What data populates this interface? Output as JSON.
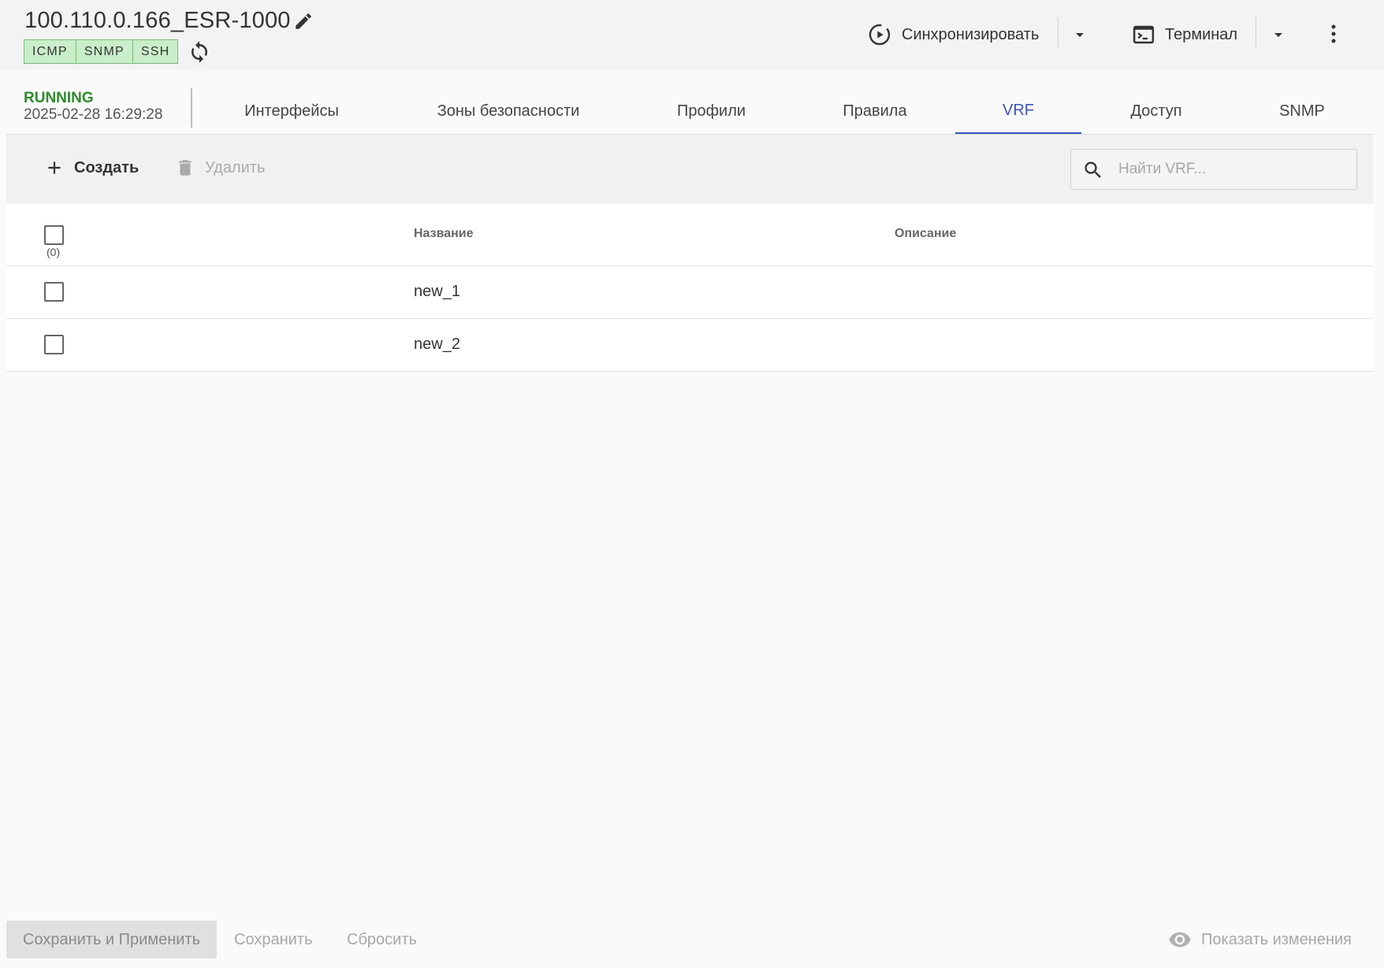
{
  "device": {
    "title": "100.110.0.166_ESR-1000",
    "protocols": [
      "ICMP",
      "SNMP",
      "SSH"
    ]
  },
  "header_actions": {
    "sync_label": "Синхронизировать",
    "terminal_label": "Терминал"
  },
  "status": {
    "state": "RUNNING",
    "timestamp": "2025-02-28 16:29:28"
  },
  "tabs": [
    {
      "label": "Интерфейсы"
    },
    {
      "label": "Зоны безопасности"
    },
    {
      "label": "Профили"
    },
    {
      "label": "Правила"
    },
    {
      "label": "VRF",
      "active": true
    },
    {
      "label": "Доступ"
    },
    {
      "label": "SNMP"
    }
  ],
  "toolbar": {
    "create_label": "Создать",
    "delete_label": "Удалить",
    "search_placeholder": "Найти VRF..."
  },
  "table": {
    "selected_count": "(0)",
    "columns": [
      "Название",
      "Описание"
    ],
    "rows": [
      {
        "name": "new_1",
        "description": ""
      },
      {
        "name": "new_2",
        "description": ""
      }
    ]
  },
  "footer": {
    "save_apply_label": "Сохранить и Применить",
    "save_label": "Сохранить",
    "reset_label": "Сбросить",
    "show_changes_label": "Показать изменения"
  },
  "colors": {
    "accent": "#3a55b8",
    "running": "#2e8b2e",
    "badge_bg": "#c9eec9"
  },
  "icons": [
    "edit-icon",
    "refresh-icon",
    "sync-icon",
    "terminal-icon",
    "chevron-down-icon",
    "more-vert-icon",
    "plus-icon",
    "trash-icon",
    "search-icon",
    "eye-icon"
  ]
}
